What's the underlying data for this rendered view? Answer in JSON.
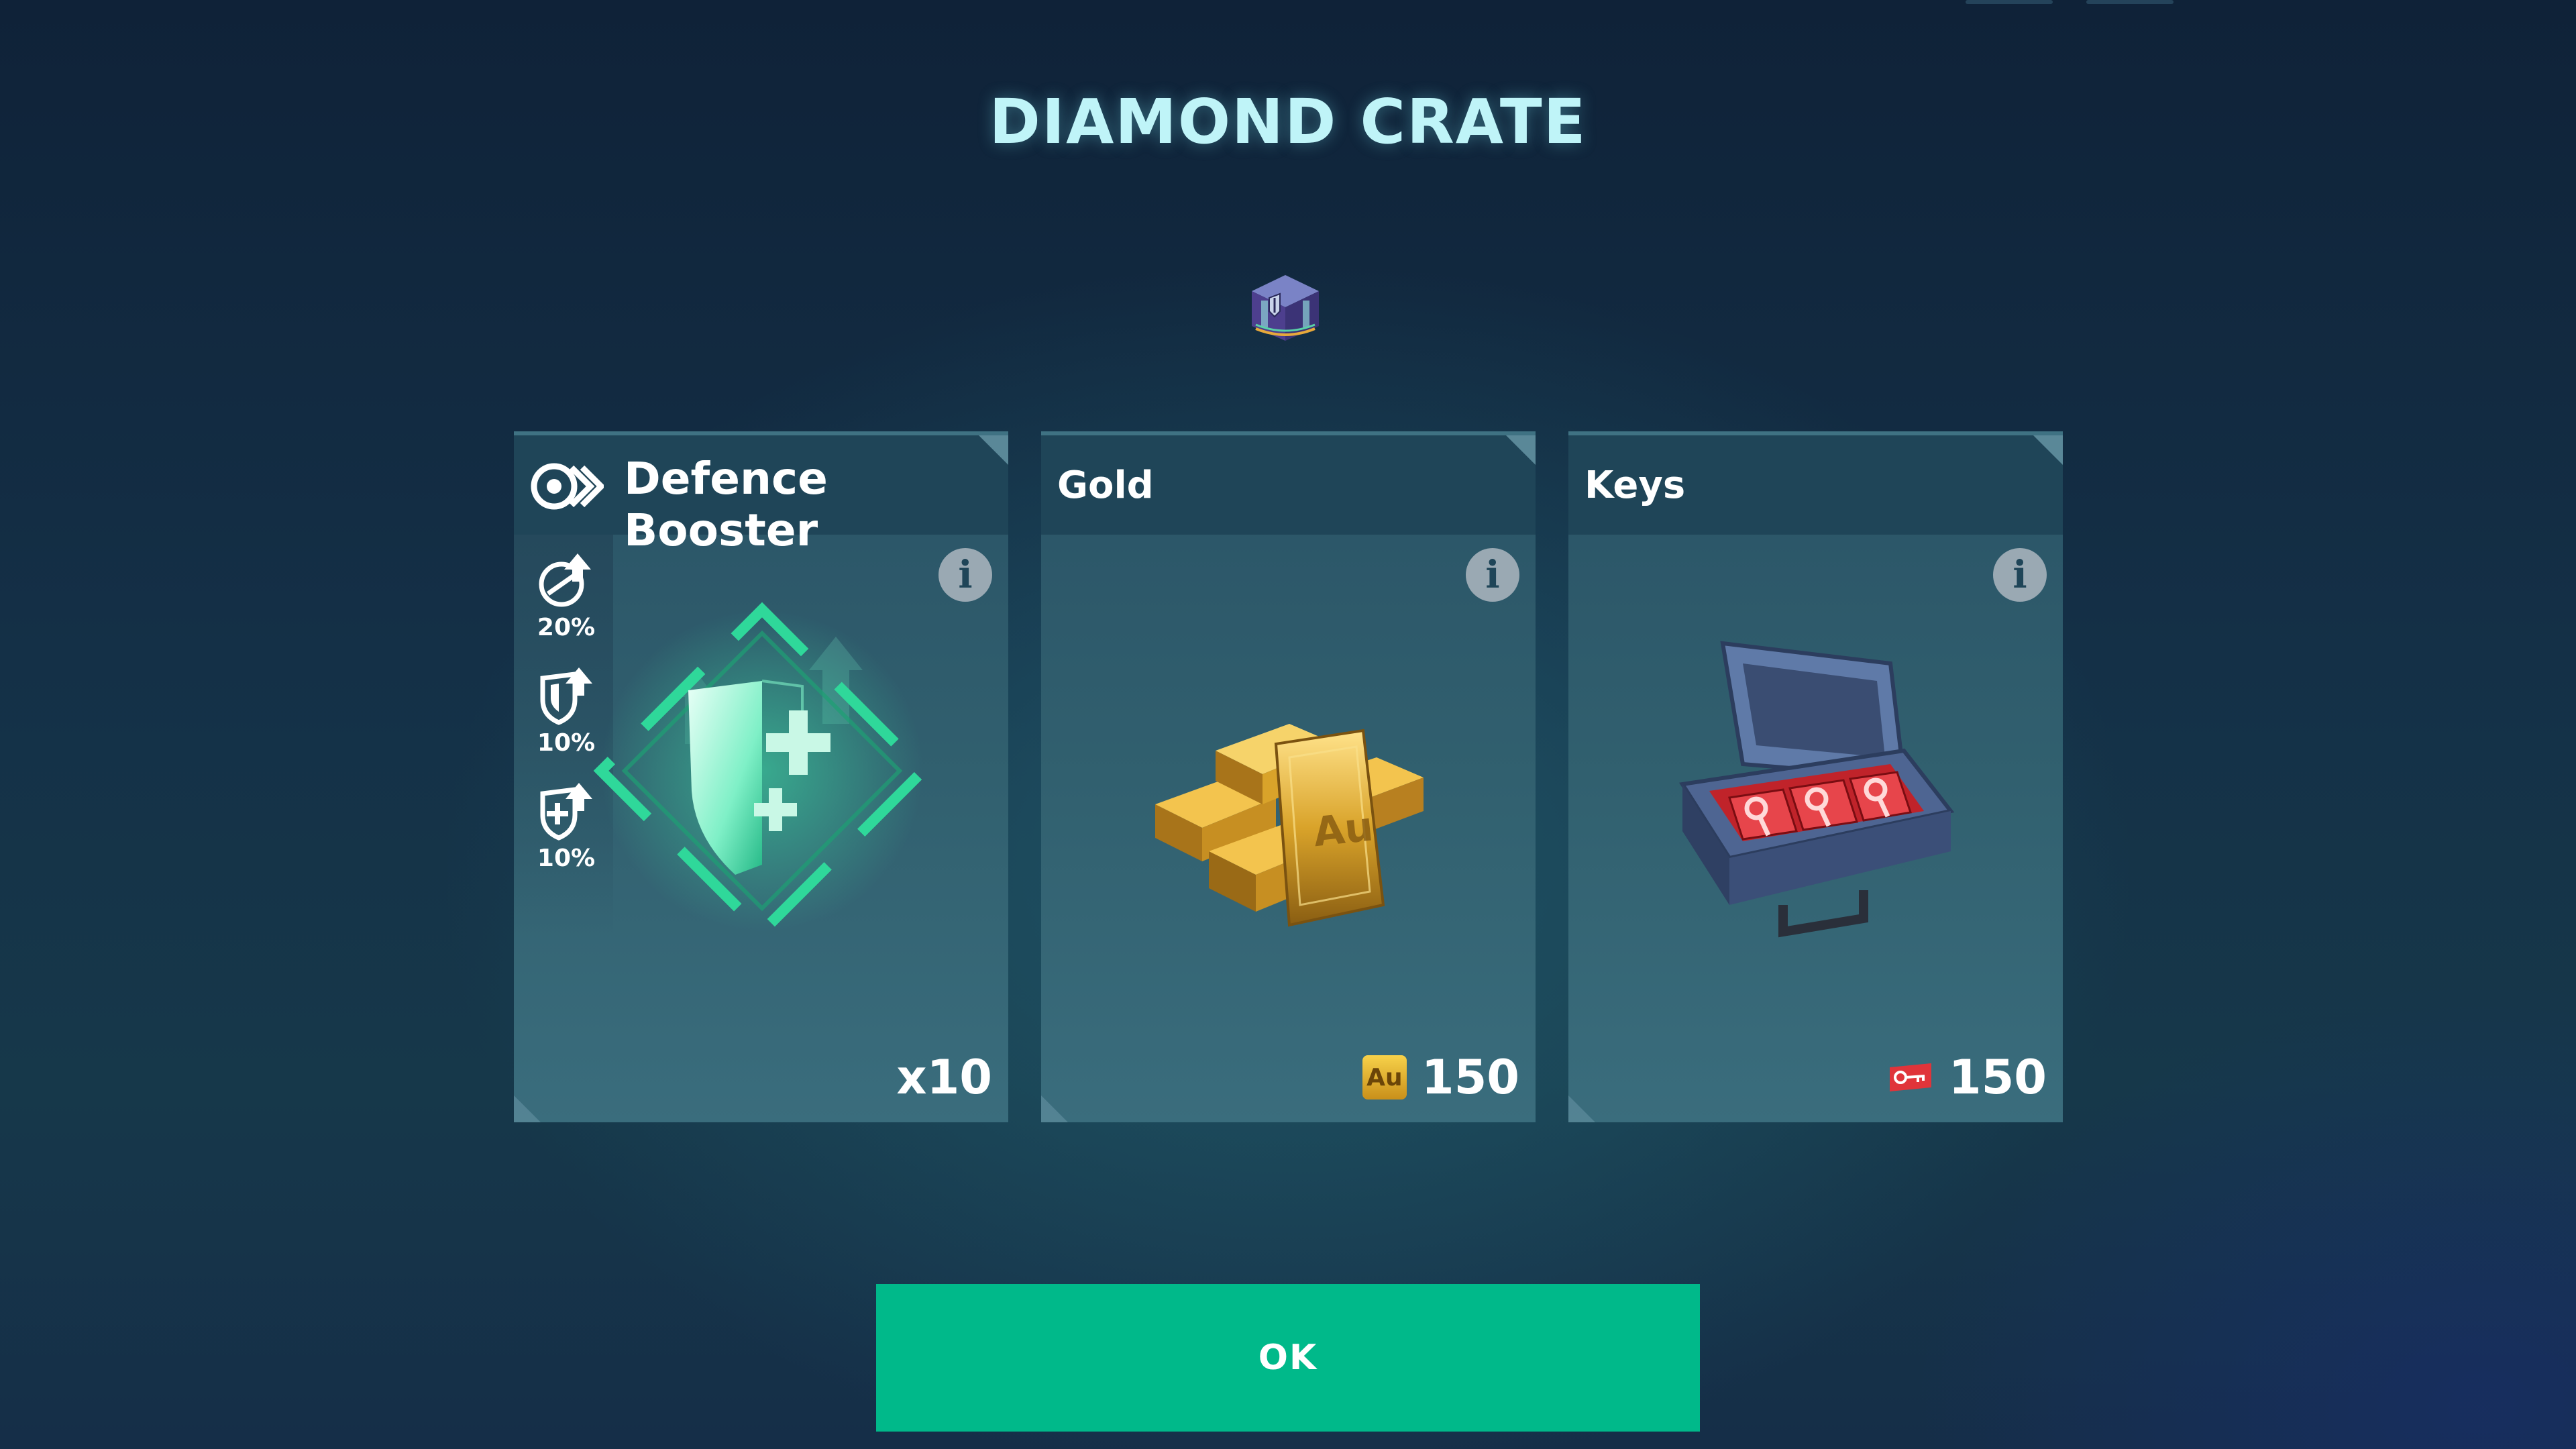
{
  "title": "DIAMOND CRATE",
  "cards": [
    {
      "name": "Defence Booster",
      "quantity": "x10",
      "stats": [
        {
          "icon": "attack-up-icon",
          "value": "20%"
        },
        {
          "icon": "shield-up-icon",
          "value": "10%"
        },
        {
          "icon": "armor-up-icon",
          "value": "10%"
        }
      ],
      "icon": "defence-booster-icon",
      "info_icon": "info-icon"
    },
    {
      "name": "Gold",
      "currency_symbol": "Au",
      "amount": "150",
      "icon": "gold-bars-icon",
      "info_icon": "info-icon"
    },
    {
      "name": "Keys",
      "amount": "150",
      "icon": "keys-case-icon",
      "currency_icon": "key-icon",
      "info_icon": "info-icon"
    }
  ],
  "ok_button": "OK",
  "colors": {
    "accent": "#00b98a",
    "title": "#bff4f8",
    "gold": "#e0b12a",
    "key_red": "#e0343a",
    "booster_green": "#2fd89a"
  }
}
